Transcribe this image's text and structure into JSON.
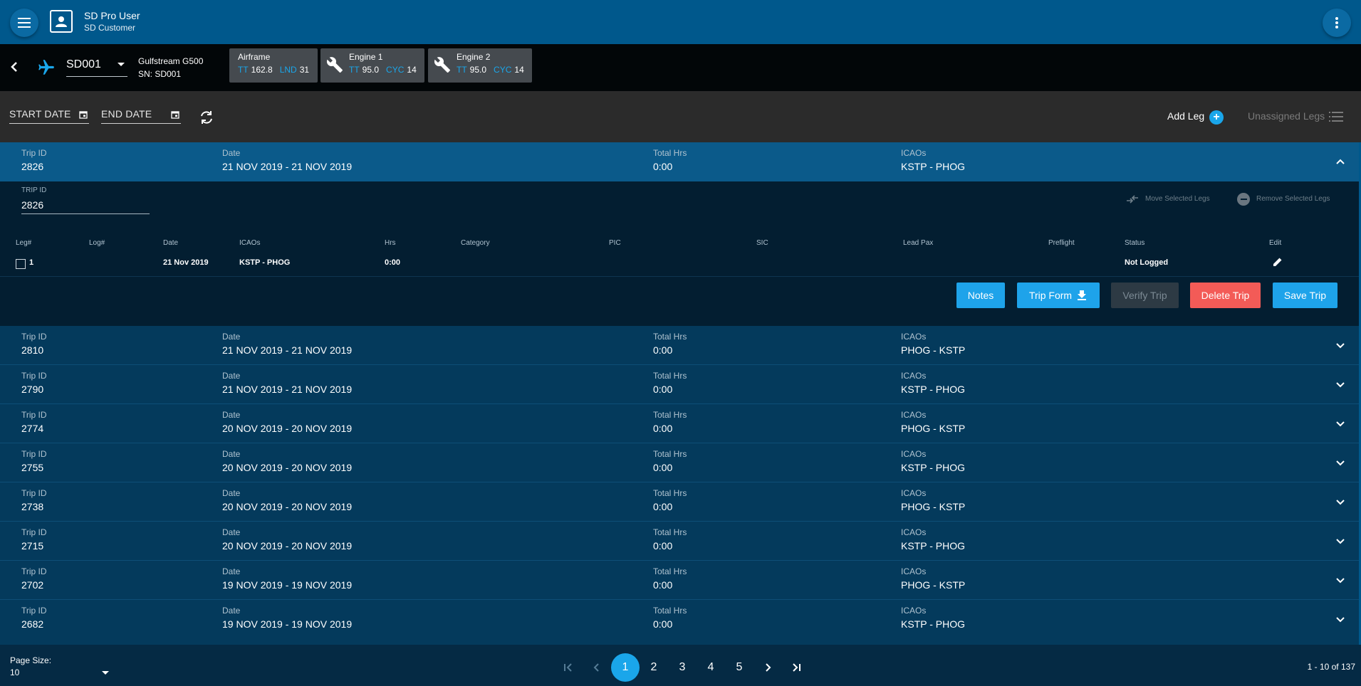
{
  "appbar": {
    "user_name": "SD Pro User",
    "user_role": "SD Customer"
  },
  "aircraft": {
    "tail": "SD001",
    "model": "Gulfstream G500",
    "serial": "SN: SD001",
    "airframe": {
      "title": "Airframe",
      "tt_label": "TT",
      "tt": "162.8",
      "lnd_label": "LND",
      "lnd": "31"
    },
    "engine1": {
      "title": "Engine 1",
      "tt_label": "TT",
      "tt": "95.0",
      "cyc_label": "CYC",
      "cyc": "14"
    },
    "engine2": {
      "title": "Engine 2",
      "tt_label": "TT",
      "tt": "95.0",
      "cyc_label": "CYC",
      "cyc": "14"
    }
  },
  "filters": {
    "start_date": "START DATE",
    "end_date": "END DATE",
    "add_leg": "Add Leg",
    "unassigned": "Unassigned Legs"
  },
  "columns": {
    "trip_id": "Trip ID",
    "date": "Date",
    "total_hrs": "Total Hrs",
    "icaos": "ICAOs"
  },
  "expanded": {
    "trip_id_label": "TRIP ID",
    "trip_id_value": "2826",
    "move_selected": "Move Selected Legs",
    "remove_selected": "Remove Selected Legs",
    "leg_headers": {
      "leg": "Leg#",
      "log": "Log#",
      "date": "Date",
      "icaos": "ICAOs",
      "hrs": "Hrs",
      "category": "Category",
      "pic": "PIC",
      "sic": "SIC",
      "lead_pax": "Lead Pax",
      "preflight": "Preflight",
      "status": "Status",
      "edit": "Edit"
    },
    "leg": {
      "num": "1",
      "date": "21 Nov 2019",
      "icaos": "KSTP - PHOG",
      "hrs": "0:00",
      "status": "Not Logged"
    },
    "buttons": {
      "notes": "Notes",
      "trip_form": "Trip Form",
      "verify": "Verify Trip",
      "delete": "Delete Trip",
      "save": "Save Trip"
    }
  },
  "trips": [
    {
      "id": "2826",
      "date": "21 NOV 2019 - 21 NOV 2019",
      "hrs": "0:00",
      "icaos": "KSTP - PHOG"
    },
    {
      "id": "2810",
      "date": "21 NOV 2019 - 21 NOV 2019",
      "hrs": "0:00",
      "icaos": "PHOG - KSTP"
    },
    {
      "id": "2790",
      "date": "21 NOV 2019 - 21 NOV 2019",
      "hrs": "0:00",
      "icaos": "KSTP - PHOG"
    },
    {
      "id": "2774",
      "date": "20 NOV 2019 - 20 NOV 2019",
      "hrs": "0:00",
      "icaos": "PHOG - KSTP"
    },
    {
      "id": "2755",
      "date": "20 NOV 2019 - 20 NOV 2019",
      "hrs": "0:00",
      "icaos": "KSTP - PHOG"
    },
    {
      "id": "2738",
      "date": "20 NOV 2019 - 20 NOV 2019",
      "hrs": "0:00",
      "icaos": "PHOG - KSTP"
    },
    {
      "id": "2715",
      "date": "20 NOV 2019 - 20 NOV 2019",
      "hrs": "0:00",
      "icaos": "KSTP - PHOG"
    },
    {
      "id": "2702",
      "date": "19 NOV 2019 - 19 NOV 2019",
      "hrs": "0:00",
      "icaos": "PHOG - KSTP"
    },
    {
      "id": "2682",
      "date": "19 NOV 2019 - 19 NOV 2019",
      "hrs": "0:00",
      "icaos": "KSTP - PHOG"
    }
  ],
  "footer": {
    "page_size_label": "Page Size:",
    "page_size": "10",
    "pages": [
      "1",
      "2",
      "3",
      "4",
      "5"
    ],
    "range": "1 - 10 of 137"
  },
  "colors": {
    "accent": "#1aa6ea",
    "appbar": "#00588c",
    "row": "#043a5c",
    "danger": "#f35b57"
  },
  "icons": [
    "menu-icon",
    "user-icon",
    "more-vert-icon",
    "back-icon",
    "airplane-icon",
    "wrench-icon",
    "calendar-icon",
    "refresh-icon",
    "add-circle-icon",
    "list-icon",
    "chevron-up-icon",
    "chevron-down-icon",
    "move-icon",
    "remove-circle-icon",
    "edit-icon",
    "download-icon",
    "first-page-icon",
    "prev-page-icon",
    "next-page-icon",
    "last-page-icon"
  ]
}
